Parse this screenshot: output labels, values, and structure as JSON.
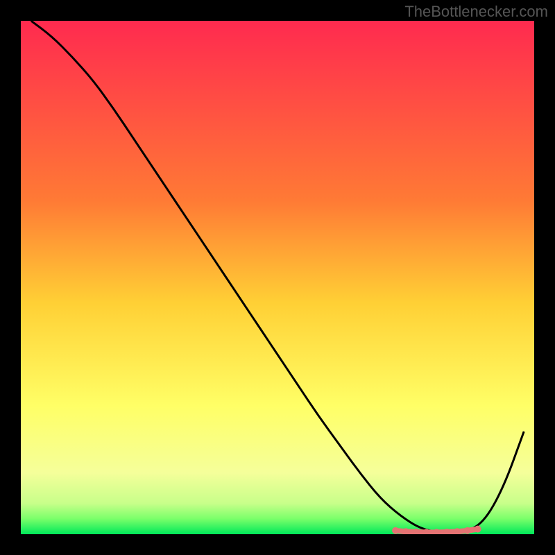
{
  "watermark": "TheBottlenecker.com",
  "chart_data": {
    "type": "line",
    "title": "",
    "xlabel": "",
    "ylabel": "",
    "xlim": [
      0,
      100
    ],
    "ylim": [
      0,
      100
    ],
    "gradient_stops": [
      {
        "offset": 0,
        "color": "#ff2a4f"
      },
      {
        "offset": 0.35,
        "color": "#ff7a35"
      },
      {
        "offset": 0.55,
        "color": "#ffd035"
      },
      {
        "offset": 0.75,
        "color": "#ffff66"
      },
      {
        "offset": 0.88,
        "color": "#f5ff9a"
      },
      {
        "offset": 0.94,
        "color": "#c8ff8a"
      },
      {
        "offset": 0.97,
        "color": "#7aff6a"
      },
      {
        "offset": 1.0,
        "color": "#00e85a"
      }
    ],
    "series": [
      {
        "name": "bottleneck-curve",
        "color": "#000000",
        "x": [
          2,
          6,
          10,
          14,
          18,
          22,
          26,
          30,
          34,
          38,
          42,
          46,
          50,
          54,
          58,
          62,
          66,
          70,
          74,
          78,
          82,
          86,
          90,
          94,
          98
        ],
        "y": [
          100,
          97,
          93,
          88.5,
          83,
          77,
          71,
          65,
          59,
          53,
          47,
          41,
          35,
          29,
          23,
          17.5,
          12,
          7,
          3.5,
          1,
          0.3,
          0.3,
          2,
          9,
          20
        ]
      },
      {
        "name": "sweet-spot",
        "color": "#e57373",
        "type": "scatter",
        "x": [
          73,
          75,
          77,
          79,
          81,
          83,
          85,
          87,
          89
        ],
        "y": [
          0.7,
          0.5,
          0.4,
          0.35,
          0.35,
          0.4,
          0.5,
          0.7,
          1.0
        ]
      }
    ]
  }
}
